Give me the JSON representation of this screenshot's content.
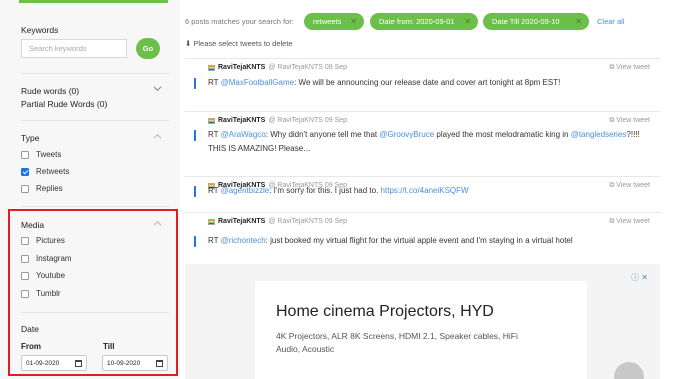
{
  "sidebar": {
    "keywords_label": "Keywords",
    "search_placeholder": "Search keywords",
    "go_label": "Go",
    "rude_words": "Rude words (0)",
    "partial_rude_words": "Partial Rude Words (0)",
    "type": {
      "title": "Type",
      "options": [
        {
          "label": "Tweets",
          "checked": false
        },
        {
          "label": "Retweets",
          "checked": true
        },
        {
          "label": "Replies",
          "checked": false
        }
      ]
    },
    "media": {
      "title": "Media",
      "options": [
        {
          "label": "Pictures",
          "checked": false
        },
        {
          "label": "Instagram",
          "checked": false
        },
        {
          "label": "Youtube",
          "checked": false
        },
        {
          "label": "Tumblr",
          "checked": false
        }
      ]
    },
    "date": {
      "title": "Date",
      "from_label": "From",
      "till_label": "Till",
      "from_value": "01-09-2020",
      "till_value": "10-09-2020"
    }
  },
  "filters": {
    "match_text": "6 posts matches your search for:",
    "pills": [
      {
        "label": "retweets"
      },
      {
        "label": "Date from: 2020-09-01"
      },
      {
        "label": "Date Till 2020-09-10"
      }
    ],
    "clear_all": "Clear all",
    "select_hint": "Please select tweets to delete"
  },
  "tweets": [
    {
      "name": "RaviTejaKNTS",
      "handle": "@ RaviTejaKNTS 09 Sep",
      "view": "View tweet",
      "text_pre": "RT ",
      "mention": "@MaxFootballGame",
      "text_post": ": We will be announcing our release date and cover art tonight at 8pm EST!"
    },
    {
      "name": "RaviTejaKNTS",
      "handle": "@ RaviTejaKNTS 09 Sep",
      "view": "View tweet",
      "text_pre": "RT ",
      "mention": "@AraWagco",
      "text_mid": ": Why didn't anyone tell me that ",
      "mention2": "@GroovyBruce",
      "text_mid2": " played the most melodramatic king in ",
      "mention3": "@tangledseries",
      "text_post": "?!!!! THIS IS AMAZING! Please…"
    },
    {
      "name": "RaviTejaKNTS",
      "handle": "@ RaviTejaKNTS 09 Sep",
      "view": "View tweet",
      "text_pre": "RT ",
      "mention": "@agentbizzle",
      "text_mid": ": I'm sorry for this. I just had to. ",
      "link": "https://t.co/4aneiKSQFW"
    },
    {
      "name": "RaviTejaKNTS",
      "handle": "@ RaviTejaKNTS 09 Sep",
      "view": "View tweet",
      "text_pre": "RT ",
      "mention": "@richontech",
      "text_post": ": just booked my virtual flight for the virtual apple event and I'm staying in a virtual hotel"
    }
  ],
  "ad": {
    "title": "Home cinema Projectors, HYD",
    "description": "4K Projectors, ALR 8K Screens, HDMI 2.1, Speaker cables, HiFi Audio, Acoustic"
  }
}
